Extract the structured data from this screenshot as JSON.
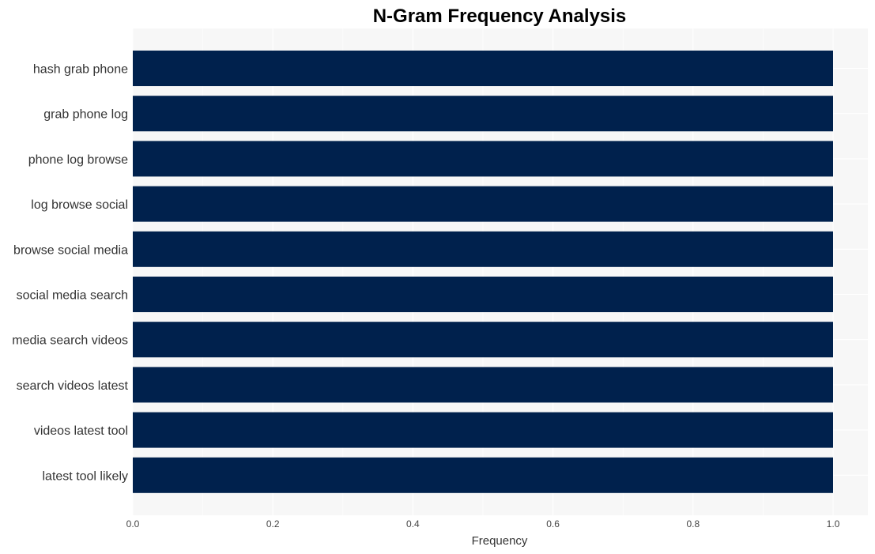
{
  "chart_data": {
    "type": "bar",
    "orientation": "horizontal",
    "title": "N-Gram Frequency Analysis",
    "xlabel": "Frequency",
    "ylabel": "",
    "categories": [
      "hash grab phone",
      "grab phone log",
      "phone log browse",
      "log browse social",
      "browse social media",
      "social media search",
      "media search videos",
      "search videos latest",
      "videos latest tool",
      "latest tool likely"
    ],
    "values": [
      1.0,
      1.0,
      1.0,
      1.0,
      1.0,
      1.0,
      1.0,
      1.0,
      1.0,
      1.0
    ],
    "xlim": [
      0.0,
      1.05
    ],
    "xticks": [
      0.0,
      0.2,
      0.4,
      0.6,
      0.8,
      1.0
    ],
    "xtick_labels": [
      "0.0",
      "0.2",
      "0.4",
      "0.6",
      "0.8",
      "1.0"
    ],
    "grid": true,
    "legend": "none",
    "colors": {
      "bar": "#00214d",
      "panel": "#f7f7f7",
      "grid": "#ffffff"
    }
  }
}
